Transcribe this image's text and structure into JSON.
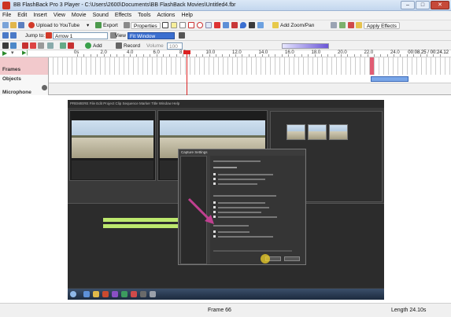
{
  "window": {
    "title": "BB FlashBack Pro 3 Player - C:\\Users\\2600\\Documents\\BB FlashBack Movies\\Untitled4.fbr",
    "controls": [
      "–",
      "□",
      "✕"
    ]
  },
  "menu": [
    "File",
    "Edit",
    "Insert",
    "View",
    "Movie",
    "Sound",
    "Effects",
    "Tools",
    "Actions",
    "Help"
  ],
  "toolbar1": {
    "upload_label": "Upload to YouTube",
    "export_label": "Export",
    "properties_label": "Properties",
    "zoom_pan_label": "Add Zoom/Pan",
    "apply_effects_label": "Apply Effects"
  },
  "toolbar2": {
    "jump_to_label": "Jump to:",
    "jump_to_value": "Arrow 1",
    "view_label": "View",
    "view_value": "Fit Window"
  },
  "toolbar3": {
    "add_label": "Add",
    "record_label": "Record",
    "volume_label": "Volume",
    "volume_value": "100"
  },
  "timeline": {
    "ruler_labels": [
      "0s",
      "2.0",
      "4.0",
      "6.0",
      "8.0",
      "10.0",
      "12.0",
      "14.0",
      "16.0",
      "18.0",
      "20.0",
      "22.0",
      "24.0"
    ],
    "time_readout": "00:08.25 / 00:24.12",
    "tracks": [
      "Frames",
      "Objects",
      "Microphone"
    ]
  },
  "video": {
    "app_menu": "PREMIERE  File  Edit  Project  Clip  Sequence  Marker  Title  Window  Help",
    "dialog_title": "Capture Settings"
  },
  "status": {
    "frame_label": "Frame 66",
    "length_label": "Length 24.10s"
  },
  "colors": {
    "accent": "#3b6fd0",
    "playhead": "#dd2222",
    "clip_green": "#bde86e"
  }
}
